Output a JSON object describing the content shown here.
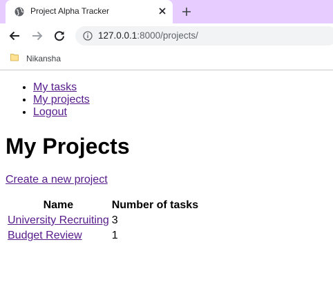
{
  "browser": {
    "tab_title": "Project Alpha Tracker",
    "url_host": "127.0.0.1",
    "url_path": ":8000/projects/",
    "bookmark_label": "Nikansha",
    "accent": "#e6ccff",
    "icons": {
      "favicon": "globe-icon",
      "tab_close": "close-icon",
      "new_tab": "plus-icon",
      "back": "arrow-left-icon",
      "forward": "arrow-right-icon",
      "reload": "reload-icon",
      "site_info": "info-icon",
      "bookmark": "folder-icon"
    }
  },
  "nav": {
    "items": [
      {
        "label": "My tasks"
      },
      {
        "label": "My projects"
      },
      {
        "label": "Logout"
      }
    ]
  },
  "page": {
    "title": "My Projects",
    "create_link": "Create a new project"
  },
  "table": {
    "headers": [
      "Name",
      "Number of tasks"
    ],
    "rows": [
      {
        "name": "University Recruiting",
        "tasks": "3"
      },
      {
        "name": "Budget Review",
        "tasks": "1"
      }
    ]
  }
}
